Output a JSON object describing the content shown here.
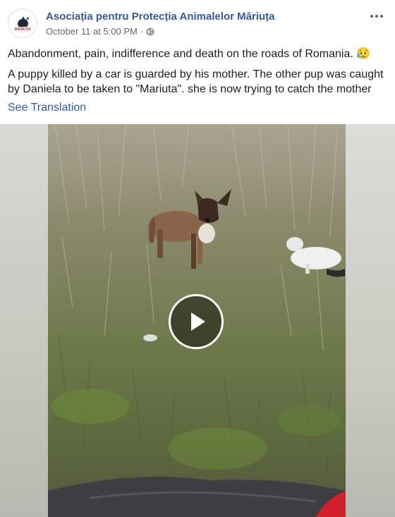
{
  "post": {
    "page_name": "Asociația pentru Protecția Animalelor Măriuța",
    "timestamp": "October 11 at 5:00 PM",
    "separator": "·",
    "privacy_icon": "globe-icon",
    "line1": "Abandonment, pain, indifference and death on the roads of Romania. 😥",
    "line2": "A puppy killed by a car is guarded by his mother. The other pup was caught by Daniela to be taken to \"Mariuta\". she is now trying to catch the mother",
    "see_translation": "See Translation"
  },
  "avatar": {
    "logo_text": "MĂRIUȚA"
  },
  "video": {
    "state": "paused",
    "play_icon": "play-icon"
  },
  "colors": {
    "link": "#385898",
    "meta": "#606770",
    "text": "#1c1e21"
  }
}
